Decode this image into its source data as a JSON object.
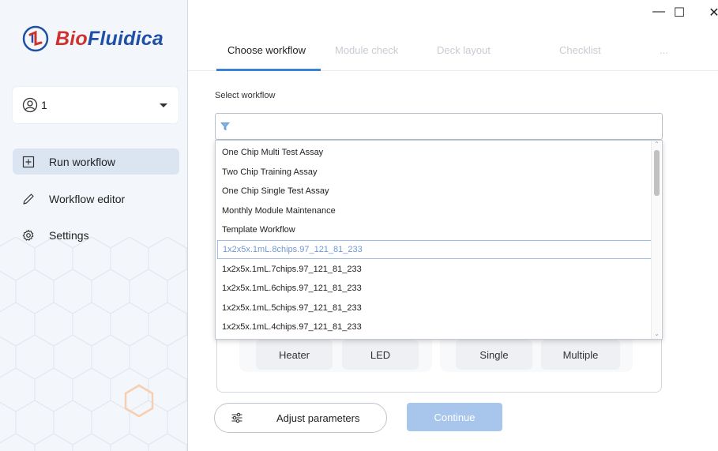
{
  "app": {
    "logo_text_bio": "Bio",
    "logo_text_rest": "Fluidica",
    "accent_color": "#3b82d6",
    "brand_color": "#1f4fa6"
  },
  "window_controls": {
    "minimize": "—",
    "maximize": "☐",
    "close": "✕"
  },
  "user": {
    "name": "1"
  },
  "sidebar": {
    "items": [
      {
        "label": "Run workflow",
        "icon": "plus-square-icon",
        "active": true
      },
      {
        "label": "Workflow editor",
        "icon": "pencil-icon",
        "active": false
      },
      {
        "label": "Settings",
        "icon": "gear-icon",
        "active": false
      }
    ]
  },
  "tabs": [
    {
      "label": "Choose workflow",
      "active": true
    },
    {
      "label": "Module check",
      "active": false
    },
    {
      "label": "Deck layout",
      "active": false
    },
    {
      "label": "Checklist",
      "active": false
    },
    {
      "label": "...",
      "active": false
    }
  ],
  "workflow_select": {
    "label": "Select workflow",
    "search_value": "",
    "options": [
      "One Chip Multi Test Assay",
      "Two Chip Training Assay",
      "One Chip Single Test Assay",
      "Monthly Module Maintenance",
      "Template Workflow",
      "1x2x5x.1mL.8chips.97_121_81_233",
      "1x2x5x.1mL.7chips.97_121_81_233",
      "1x2x5x.1mL.6chips.97_121_81_233",
      "1x2x5x.1mL.5chips.97_121_81_233",
      "1x2x5x.1mL.4chips.97_121_81_233"
    ],
    "highlighted_index": 5
  },
  "modules": {
    "tiles": [
      "Heater",
      "LED",
      "Single",
      "Multiple"
    ]
  },
  "actions": {
    "adjust_label": "Adjust parameters",
    "continue_label": "Continue"
  }
}
